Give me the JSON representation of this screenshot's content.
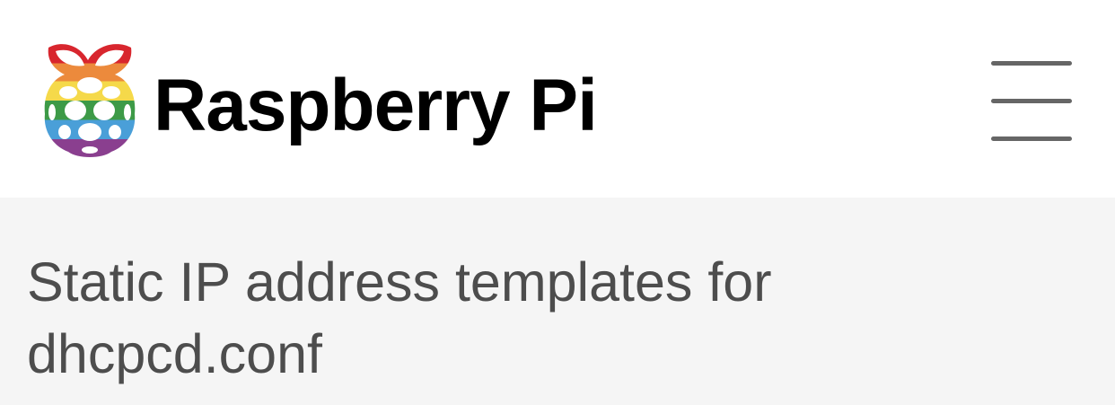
{
  "header": {
    "brand": "Raspberry Pi",
    "logo_icon": "raspberry-pi-rainbow-logo",
    "menu_icon": "hamburger-menu-icon",
    "logo_colors": [
      "#d8262e",
      "#ec8a3c",
      "#f5d94a",
      "#3d9a47",
      "#4a9fd8",
      "#8a3f8f"
    ]
  },
  "page": {
    "title": "Static IP address templates for dhcpcd.conf"
  }
}
